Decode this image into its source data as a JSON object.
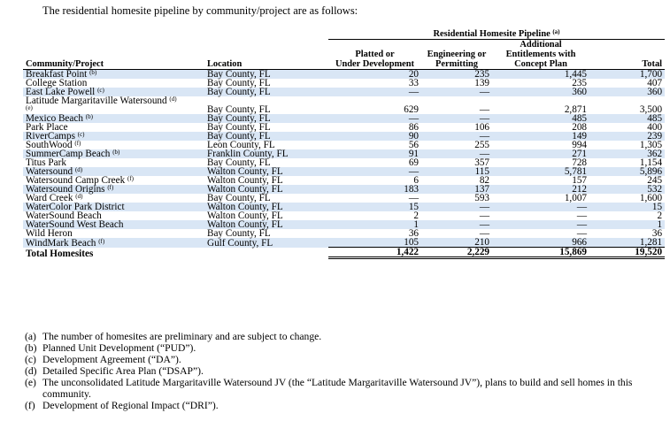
{
  "intro": "The residential homesite pipeline by community/project are as follows:",
  "table": {
    "group_header": "Residential Homesite Pipeline",
    "group_header_note": "(a)",
    "columns": {
      "community": "Community/Project",
      "location": "Location",
      "platted": [
        "Platted or",
        "Under Development"
      ],
      "engineering": [
        "Engineering or",
        "Permitting"
      ],
      "additional": [
        "Additional",
        "Entitlements with",
        "Concept Plan"
      ],
      "total": "Total"
    },
    "rows": [
      {
        "name": "Breakfast Point",
        "note": "(b)",
        "location": "Bay County, FL",
        "platted": "20",
        "eng": "235",
        "add": "1,445",
        "total": "1,700"
      },
      {
        "name": "College Station",
        "note": "",
        "location": "Bay County, FL",
        "platted": "33",
        "eng": "139",
        "add": "235",
        "total": "407"
      },
      {
        "name": "East Lake Powell",
        "note": "(c)",
        "location": "Bay County, FL",
        "platted": "—",
        "eng": "—",
        "add": "360",
        "total": "360"
      },
      {
        "name": "Latitude Margaritaville Watersound",
        "note": "(d)",
        "note2": "(e)",
        "location": "Bay County, FL",
        "platted": "629",
        "eng": "—",
        "add": "2,871",
        "total": "3,500"
      },
      {
        "name": "Mexico Beach",
        "note": "(b)",
        "location": "Bay County, FL",
        "platted": "—",
        "eng": "—",
        "add": "485",
        "total": "485"
      },
      {
        "name": "Park Place",
        "note": "",
        "location": "Bay County, FL",
        "platted": "86",
        "eng": "106",
        "add": "208",
        "total": "400"
      },
      {
        "name": "RiverCamps",
        "note": "(c)",
        "location": "Bay County, FL",
        "platted": "90",
        "eng": "—",
        "add": "149",
        "total": "239"
      },
      {
        "name": "SouthWood",
        "note": "(f)",
        "location": "Leon County, FL",
        "platted": "56",
        "eng": "255",
        "add": "994",
        "total": "1,305"
      },
      {
        "name": "SummerCamp Beach",
        "note": "(b)",
        "location": "Franklin County, FL",
        "platted": "91",
        "eng": "—",
        "add": "271",
        "total": "362"
      },
      {
        "name": "Titus Park",
        "note": "",
        "location": "Bay County, FL",
        "platted": "69",
        "eng": "357",
        "add": "728",
        "total": "1,154"
      },
      {
        "name": "Watersound",
        "note": "(d)",
        "location": "Walton County, FL",
        "platted": "—",
        "eng": "115",
        "add": "5,781",
        "total": "5,896"
      },
      {
        "name": "Watersound Camp Creek",
        "note": "(f)",
        "location": "Walton County, FL",
        "platted": "6",
        "eng": "82",
        "add": "157",
        "total": "245"
      },
      {
        "name": "Watersound Origins",
        "note": "(f)",
        "location": "Walton County, FL",
        "platted": "183",
        "eng": "137",
        "add": "212",
        "total": "532"
      },
      {
        "name": "Ward Creek",
        "note": "(d)",
        "location": "Bay County, FL",
        "platted": "—",
        "eng": "593",
        "add": "1,007",
        "total": "1,600"
      },
      {
        "name": "WaterColor Park District",
        "note": "",
        "location": "Walton County, FL",
        "platted": "15",
        "eng": "—",
        "add": "—",
        "total": "15"
      },
      {
        "name": "WaterSound Beach",
        "note": "",
        "location": "Walton County, FL",
        "platted": "2",
        "eng": "—",
        "add": "—",
        "total": "2"
      },
      {
        "name": "WaterSound West Beach",
        "note": "",
        "location": "Walton County, FL",
        "platted": "1",
        "eng": "—",
        "add": "—",
        "total": "1"
      },
      {
        "name": "Wild Heron",
        "note": "",
        "location": "Bay County, FL",
        "platted": "36",
        "eng": "—",
        "add": "—",
        "total": "36"
      },
      {
        "name": "WindMark Beach",
        "note": "(f)",
        "location": "Gulf County, FL",
        "platted": "105",
        "eng": "210",
        "add": "966",
        "total": "1,281"
      }
    ],
    "total_row": {
      "label": "Total Homesites",
      "platted": "1,422",
      "eng": "2,229",
      "add": "15,869",
      "total": "19,520"
    }
  },
  "notes": [
    {
      "mark": "(a)",
      "text": "The number of homesites are preliminary and are subject to change."
    },
    {
      "mark": "(b)",
      "text": "Planned Unit Development (“PUD”)."
    },
    {
      "mark": "(c)",
      "text": "Development Agreement (“DA”)."
    },
    {
      "mark": "(d)",
      "text": "Detailed Specific Area Plan (“DSAP”)."
    },
    {
      "mark": "(e)",
      "text": "The unconsolidated Latitude Margaritaville Watersound JV (the “Latitude Margaritaville Watersound JV”), plans to build and sell homes in this community."
    },
    {
      "mark": "(f)",
      "text": "Development of Regional Impact (“DRI”)."
    }
  ],
  "colors": {
    "row_shade": "#d9e6f5"
  }
}
